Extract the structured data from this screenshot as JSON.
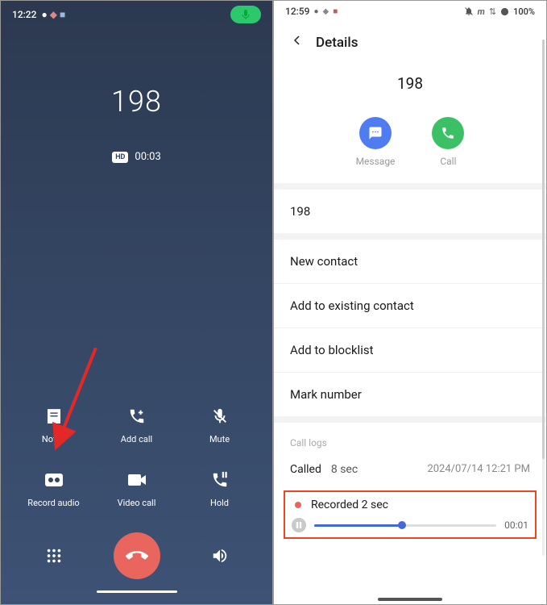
{
  "left_screen": {
    "status": {
      "time": "12:22"
    },
    "call": {
      "number": "198",
      "hd_label": "HD",
      "duration": "00:03"
    },
    "actions": {
      "notes": "Notes",
      "add_call": "Add call",
      "mute": "Mute",
      "record_audio": "Record audio",
      "video_call": "Video call",
      "hold": "Hold"
    }
  },
  "right_screen": {
    "status": {
      "time": "12:59",
      "battery": "100%"
    },
    "header": "Details",
    "number": "198",
    "message_label": "Message",
    "call_label": "Call",
    "secondary_number": "198",
    "options": {
      "new_contact": "New contact",
      "add_existing_contact": "Add to existing contact",
      "add_to_blocklist": "Add to blocklist",
      "mark_number": "Mark number"
    },
    "call_logs_label": "Call logs",
    "log": {
      "type": "Called",
      "duration": "8 sec",
      "date": "2024/07/14 12:21 PM"
    },
    "recording": {
      "label": "Recorded 2 sec",
      "time": "00:01"
    }
  }
}
